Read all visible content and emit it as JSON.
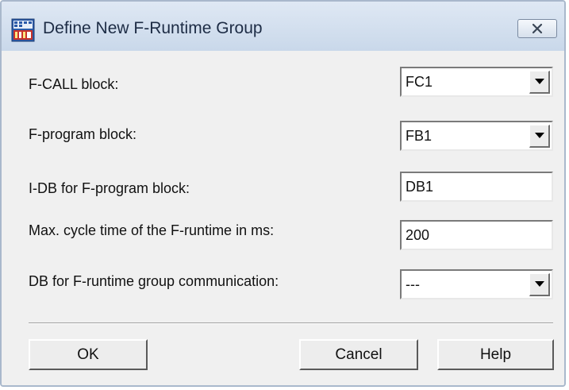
{
  "window": {
    "title": "Define New F-Runtime Group"
  },
  "form": {
    "fcall_label": "F-CALL block:",
    "fcall_value": "FC1",
    "fprogram_label": "F-program block:",
    "fprogram_value": "FB1",
    "idb_label": "I-DB for F-program block:",
    "idb_value": "DB1",
    "cycle_label": "Max. cycle time of the F-runtime in ms:",
    "cycle_value": "200",
    "db_comm_label": "DB for F-runtime group communication:",
    "db_comm_value": "---"
  },
  "buttons": {
    "ok": "OK",
    "cancel": "Cancel",
    "help": "Help"
  },
  "icons": {
    "app": "app-icon",
    "close": "close-icon",
    "dropdown": "chevron-down-icon"
  },
  "colors": {
    "titlebar": "#c9d8ea",
    "client": "#f0f0f0",
    "app_icon_red": "#c8322a",
    "app_icon_blue": "#2b5aa8"
  }
}
